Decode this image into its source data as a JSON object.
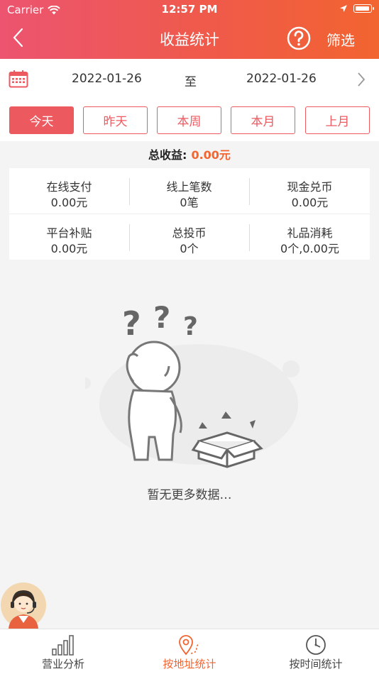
{
  "status_bar": {
    "carrier": "Carrier",
    "time": "12:57 PM"
  },
  "nav": {
    "title": "收益统计",
    "filter_label": "筛选"
  },
  "date_range": {
    "start": "2022-01-26",
    "separator": "至",
    "end": "2022-01-26"
  },
  "quick_filters": [
    {
      "label": "今天",
      "active": true
    },
    {
      "label": "昨天",
      "active": false
    },
    {
      "label": "本周",
      "active": false
    },
    {
      "label": "本月",
      "active": false
    },
    {
      "label": "上月",
      "active": false
    }
  ],
  "total": {
    "label": "总收益:",
    "value": "0.00元"
  },
  "stats": [
    {
      "label": "在线支付",
      "value": "0.00元"
    },
    {
      "label": "线上笔数",
      "value": "0笔"
    },
    {
      "label": "现金兑币",
      "value": "0.00元"
    },
    {
      "label": "平台补贴",
      "value": "0.00元"
    },
    {
      "label": "总投币",
      "value": "0个"
    },
    {
      "label": "礼品消耗",
      "value": "0个,0.00元"
    }
  ],
  "empty_state": {
    "text": "暂无更多数据…"
  },
  "tabbar": [
    {
      "label": "营业分析",
      "icon": "bar-chart-icon",
      "active": false
    },
    {
      "label": "按地址统计",
      "icon": "location-pin-icon",
      "active": true
    },
    {
      "label": "按时间统计",
      "icon": "clock-icon",
      "active": false
    }
  ],
  "colors": {
    "accent": "#ec5a60",
    "orange": "#f26430",
    "header_start": "#ec5470",
    "header_end": "#f26430"
  }
}
